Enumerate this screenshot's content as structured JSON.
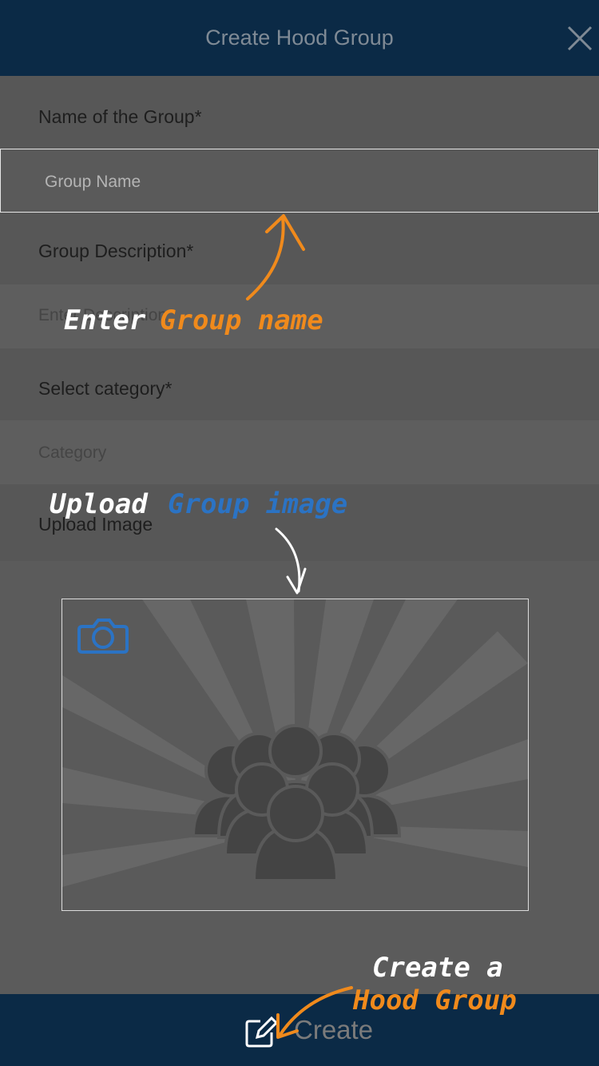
{
  "header": {
    "title": "Create Hood Group"
  },
  "form": {
    "name_label": "Name of the Group*",
    "name_placeholder": "Group Name",
    "description_label": "Group Description*",
    "description_placeholder": "Enter Description",
    "category_label": "Select category*",
    "category_placeholder": "Category",
    "upload_label": "Upload Image"
  },
  "footer": {
    "create_label": "Create"
  },
  "tutorial": {
    "enter_word": "Enter",
    "group_name_words": "Group name",
    "upload_word": "Upload",
    "group_image_words": "Group image",
    "create_a_words": "Create a",
    "hood_group_words": "Hood Group"
  },
  "colors": {
    "header_bg": "#0b2a46",
    "accent_orange": "#f08a1c",
    "accent_blue": "#2b73c4"
  },
  "icons": {
    "close": "close-icon",
    "camera": "camera-icon",
    "group": "group-people-icon",
    "edit": "edit-icon"
  }
}
